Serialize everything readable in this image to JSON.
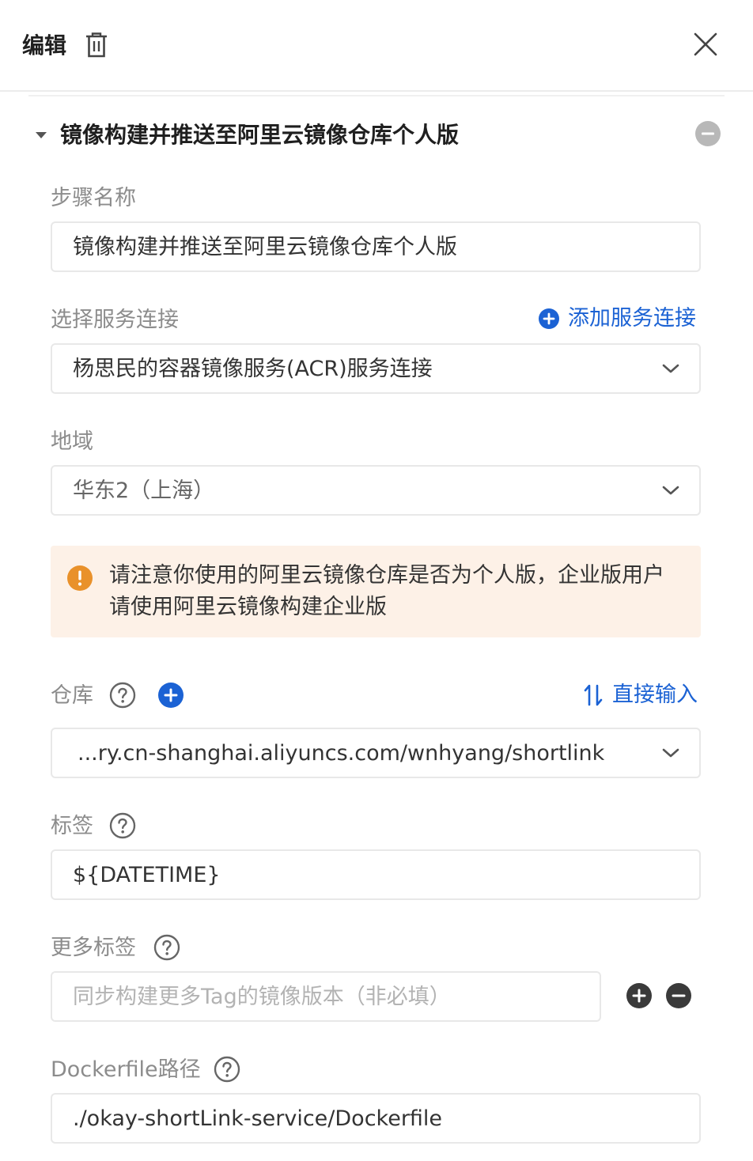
{
  "header": {
    "title": "编辑",
    "icons": {
      "delete": "trash-icon",
      "close": "close-icon"
    }
  },
  "section": {
    "title": "镜像构建并推送至阿里云镜像仓库个人版"
  },
  "step_name": {
    "label": "步骤名称",
    "value": "镜像构建并推送至阿里云镜像仓库个人版"
  },
  "service_connection": {
    "label": "选择服务连接",
    "add_link": "添加服务连接",
    "value": "杨思民的容器镜像服务(ACR)服务连接"
  },
  "region": {
    "label": "地域",
    "value": "华东2（上海）"
  },
  "alert": {
    "text": "请注意你使用的阿里云镜像仓库是否为个人版，企业版用户请使用阿里云镜像构建企业版"
  },
  "repository": {
    "label": "仓库",
    "direct_input_link": "直接输入",
    "value": "...ry.cn-shanghai.aliyuncs.com/wnhyang/shortlink"
  },
  "tag": {
    "label": "标签",
    "value": "${DATETIME}"
  },
  "more_tags": {
    "label": "更多标签",
    "placeholder": "同步构建更多Tag的镜像版本（非必填）"
  },
  "dockerfile": {
    "label": "Dockerfile路径",
    "value": "./okay-shortLink-service/Dockerfile"
  },
  "colors": {
    "accent": "#1b62d4",
    "warning": "#e9912a",
    "alert_bg": "#fdf1e7",
    "label": "#8c8c8c"
  }
}
